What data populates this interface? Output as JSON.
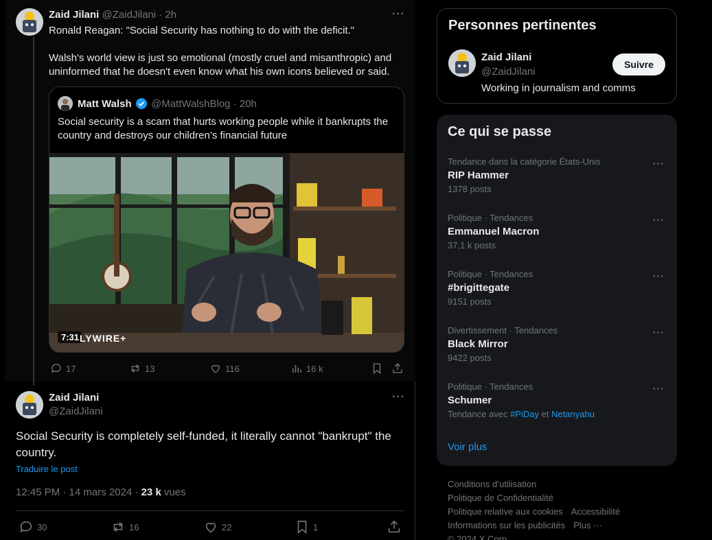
{
  "thread_tweet": {
    "author_name": "Zaid Jilani",
    "author_handle": "@ZaidJilani",
    "time": "· 2h",
    "text_line1": "Ronald Reagan: \"Social Security has nothing to do with the deficit.\"",
    "text_line2": "Walsh's world view is just so emotional (mostly cruel and misanthropic) and uninformed that he doesn't even know what his own icons believed or said.",
    "quote": {
      "author_name": "Matt Walsh",
      "author_handle": "@MattWalshBlog",
      "time": "· 20h",
      "text": "Social security is a scam that hurts working people while it bankrupts the country and destroys our children’s financial future",
      "video_duration": "7:31",
      "video_watermark": "LYWIRE+"
    },
    "actions": {
      "replies": "17",
      "reposts": "13",
      "likes": "116",
      "views": "16 k"
    }
  },
  "main_tweet": {
    "author_name": "Zaid Jilani",
    "author_handle": "@ZaidJilani",
    "text": "Social Security is completely self-funded, it literally cannot \"bankrupt\" the country.",
    "translate_label": "Traduire le post",
    "timestamp": "12:45 PM · 14 mars 2024 · ",
    "views_count": "23 k",
    "views_label": " vues",
    "actions": {
      "replies": "30",
      "reposts": "16",
      "likes": "22",
      "bookmarks": "1"
    }
  },
  "sidebar": {
    "relevant_people": {
      "title": "Personnes pertinentes",
      "name": "Zaid Jilani",
      "handle": "@ZaidJilani",
      "bio": "Working in journalism and comms",
      "follow_label": "Suivre"
    },
    "trends": {
      "title": "Ce qui se passe",
      "items": [
        {
          "category": "Tendance dans la catégorie États-Unis",
          "name": "RIP Hammer",
          "count": "1378 posts"
        },
        {
          "category": "Politique · Tendances",
          "name": "Emmanuel Macron",
          "count": "37,1 k posts"
        },
        {
          "category": "Politique · Tendances",
          "name": "#brigittegate",
          "count": "9151 posts"
        },
        {
          "category": "Divertissement · Tendances",
          "name": "Black Mirror",
          "count": "9422 posts"
        },
        {
          "category": "Politique · Tendances",
          "name": "Schumer",
          "with_prefix": "Tendance avec ",
          "with_tag1": "#PiDay",
          "with_sep": " et ",
          "with_tag2": "Netanyahu"
        }
      ],
      "see_more": "Voir plus"
    },
    "footer": {
      "terms": "Conditions d’utilisation",
      "privacy": "Politique de Confidentialité",
      "cookies": "Politique relative aux cookies",
      "accessibility": "Accessibilité",
      "ads": "Informations sur les publicités",
      "more": "Plus ···",
      "copyright": "© 2024 X Corp."
    }
  },
  "colors": {
    "accent": "#1d9bf0",
    "background": "#000000",
    "muted": "#71767b",
    "panel": "#16181c"
  }
}
